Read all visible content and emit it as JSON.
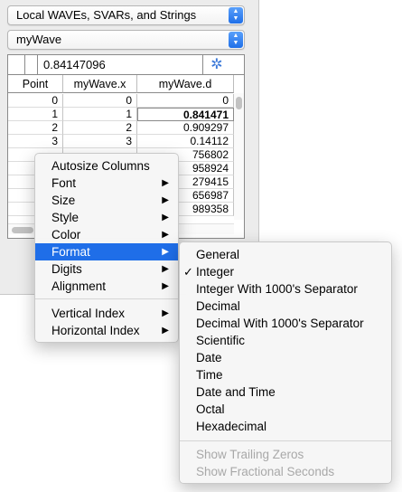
{
  "dropdowns": {
    "source": "Local WAVEs, SVARs, and Strings",
    "wave": "myWave"
  },
  "table": {
    "entry_value": "0.84147096",
    "columns": [
      "Point",
      "myWave.x",
      "myWave.d"
    ],
    "rows": [
      [
        "0",
        "0",
        "0"
      ],
      [
        "1",
        "1",
        "0.841471"
      ],
      [
        "2",
        "2",
        "0.909297"
      ],
      [
        "3",
        "3",
        "0.14112"
      ],
      [
        "",
        "",
        "756802"
      ],
      [
        "",
        "",
        "958924"
      ],
      [
        "",
        "",
        "279415"
      ],
      [
        "",
        "",
        "656987"
      ],
      [
        "",
        "",
        "989358"
      ]
    ]
  },
  "context_menu": {
    "items": [
      {
        "label": "Autosize Columns",
        "submenu": false
      },
      {
        "label": "Font",
        "submenu": true
      },
      {
        "label": "Size",
        "submenu": true
      },
      {
        "label": "Style",
        "submenu": true
      },
      {
        "label": "Color",
        "submenu": true
      },
      {
        "label": "Format",
        "submenu": true
      },
      {
        "label": "Digits",
        "submenu": true
      },
      {
        "label": "Alignment",
        "submenu": true
      },
      {
        "label": "Vertical Index",
        "submenu": true
      },
      {
        "label": "Horizontal Index",
        "submenu": true
      }
    ],
    "highlighted": "Format"
  },
  "format_submenu": {
    "items": [
      {
        "label": "General",
        "checked": false,
        "enabled": true
      },
      {
        "label": "Integer",
        "checked": true,
        "enabled": true
      },
      {
        "label": "Integer With 1000's Separator",
        "checked": false,
        "enabled": true
      },
      {
        "label": "Decimal",
        "checked": false,
        "enabled": true
      },
      {
        "label": "Decimal With 1000's Separator",
        "checked": false,
        "enabled": true
      },
      {
        "label": "Scientific",
        "checked": false,
        "enabled": true
      },
      {
        "label": "Date",
        "checked": false,
        "enabled": true
      },
      {
        "label": "Time",
        "checked": false,
        "enabled": true
      },
      {
        "label": "Date and Time",
        "checked": false,
        "enabled": true
      },
      {
        "label": "Octal",
        "checked": false,
        "enabled": true
      },
      {
        "label": "Hexadecimal",
        "checked": false,
        "enabled": true
      },
      {
        "label": "Show Trailing Zeros",
        "checked": false,
        "enabled": false
      },
      {
        "label": "Show Fractional Seconds",
        "checked": false,
        "enabled": false
      }
    ]
  },
  "icons": {
    "checkmark": "✓",
    "submenu_arrow": "▶",
    "popup_arrows": "▲▼",
    "settings": "✲"
  },
  "colors": {
    "accent": "#1f6ee8",
    "disabled_text": "#a8a8a8"
  }
}
